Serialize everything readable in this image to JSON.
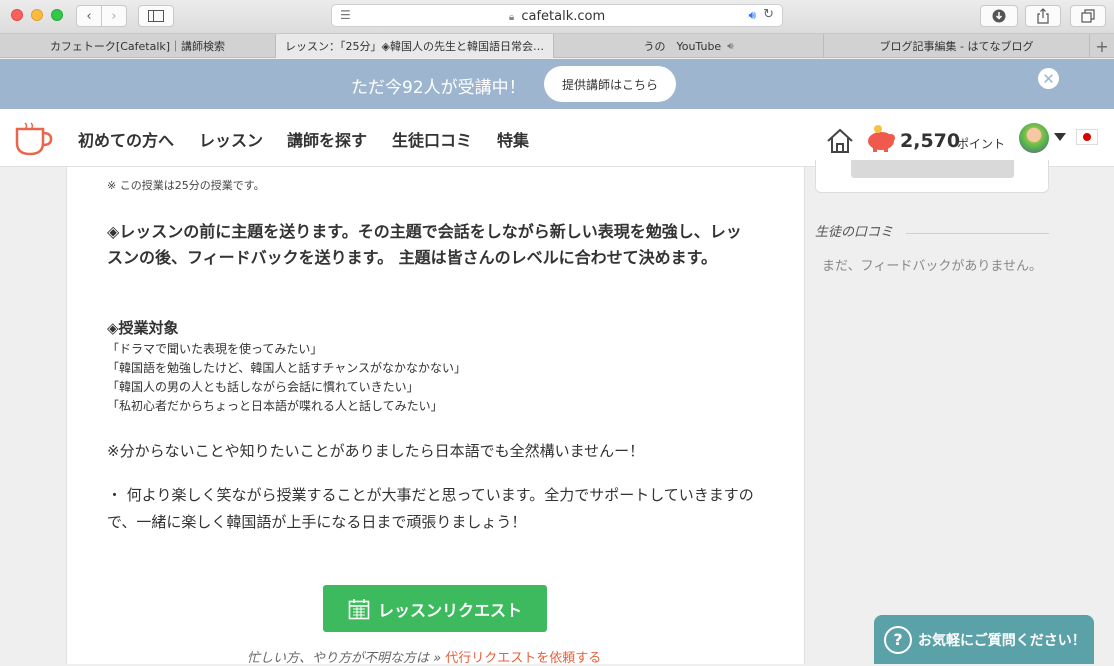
{
  "browser": {
    "url": "cafetalk.com",
    "tabs": [
      {
        "label": "カフェトーク[Cafetalk]｜講師検索",
        "active": false,
        "audio": false
      },
      {
        "label": "レッスン：「25分」◈韓国人の先生と韓国語日常会…",
        "active": true,
        "audio": false
      },
      {
        "label": "うの　YouTube",
        "active": false,
        "audio": true
      },
      {
        "label": "ブログ記事編集 - はてなブログ",
        "active": false,
        "audio": false
      }
    ],
    "new_tab": "+"
  },
  "banner": {
    "text": "ただ今92人が受講中！",
    "button": "提供講師はこちら",
    "close": "✕"
  },
  "nav": {
    "items": [
      "初めての方へ",
      "レッスン",
      "講師を探す",
      "生徒口コミ",
      "特集"
    ],
    "points_value": "2,570",
    "points_unit": "ポイント"
  },
  "lesson": {
    "note": "※ この授業は25分の授業です。",
    "intro": "◈レッスンの前に主題を送ります。その主題で会話をしながら新しい表現を勉強し、レッスンの後、フィードバックを送ります。 主題は皆さんのレベルに合わせて決めます。",
    "target_heading": "◈授業対象",
    "targets": [
      " 「ドラマで聞いた表現を使ってみたい」",
      "「韓国語を勉強したけど、韓国人と話すチャンスがなかなかない」",
      "「韓国人の男の人とも話しながら会話に慣れていきたい」",
      "「私初心者だからちょっと日本語が喋れる人と話してみたい」"
    ],
    "notice": "※分からないことや知りたいことがありましたら日本語でも全然構いませんー！",
    "closing": "・ 何より楽しく笑ながら授業することが大事だと思っています。全力でサポートしていきますので、一緒に楽しく韓国語が上手になる日まで頑張りましょう！",
    "request_button": "レッスンリクエスト",
    "busy_text": "忙しい方、やり方が不明な方は » ",
    "busy_link": "代行リクエストを依頼する"
  },
  "sidebar": {
    "reviews_title": "生徒の口コミ",
    "reviews_empty": "まだ、フィードバックがありません。"
  },
  "help": {
    "label": "お気軽にご質問ください！",
    "icon": "?"
  },
  "colors": {
    "banner": "#9db5cf",
    "accent_green": "#3dba5e",
    "help": "#5aa1a8",
    "link": "#e8603c"
  }
}
